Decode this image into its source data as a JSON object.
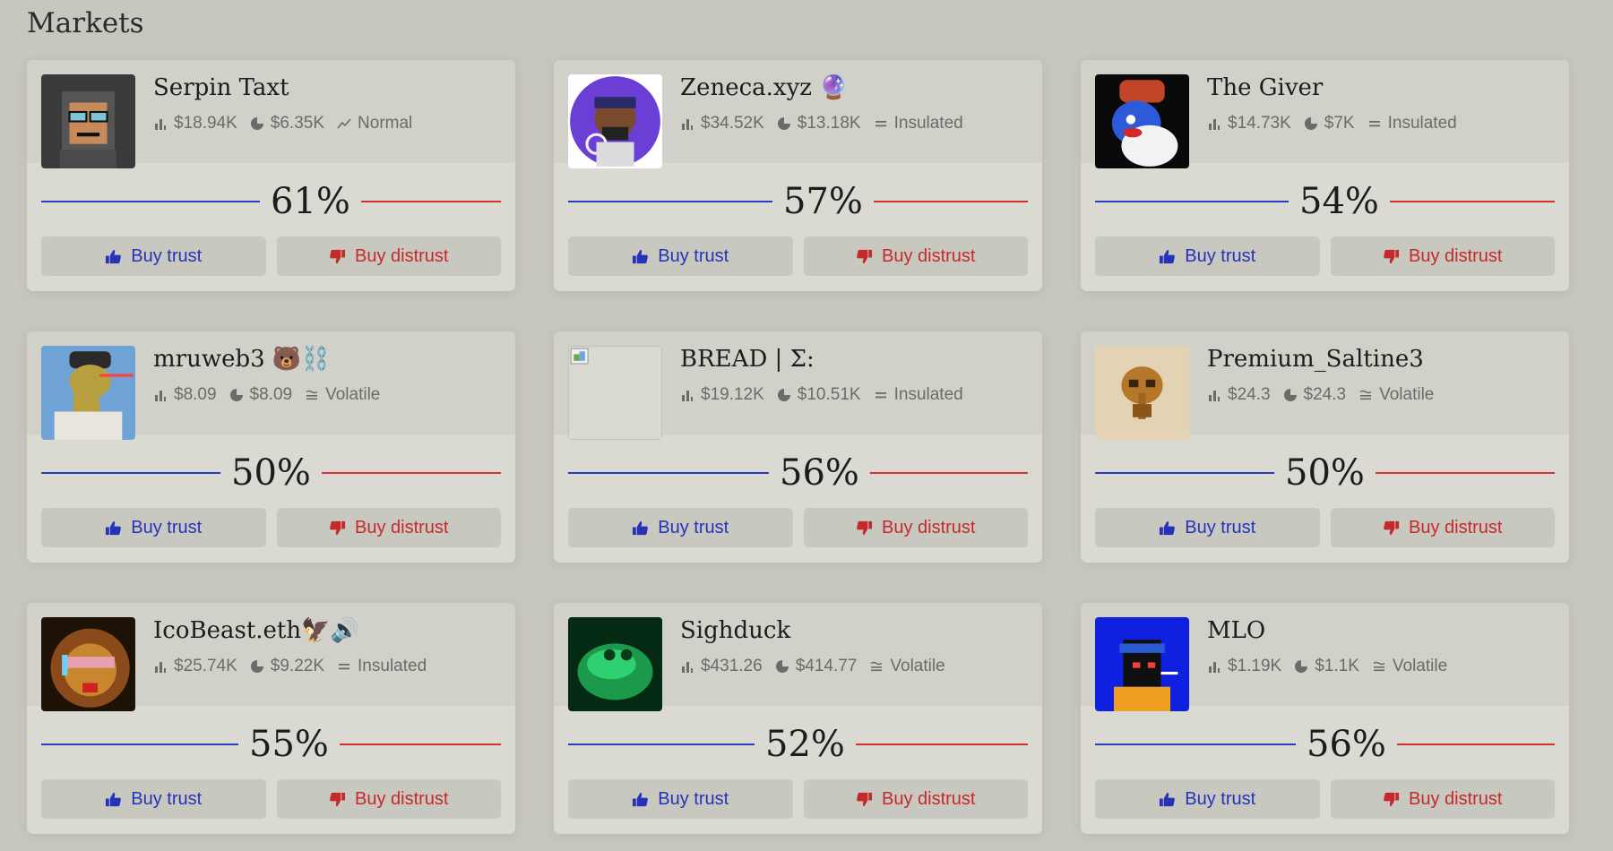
{
  "page": {
    "title": "Markets"
  },
  "markets": [
    {
      "name": "Serpin Taxt",
      "stat1": "$18.94K",
      "stat2": "$6.35K",
      "risk": "Normal",
      "risk_icon": "trend-icon",
      "trust_pct": 61,
      "pct_label": "61%",
      "buy_trust": "Buy trust",
      "buy_distrust": "Buy distrust",
      "avatar": "hooded-pixel-avatar"
    },
    {
      "name": "Zeneca.xyz 🔮",
      "stat1": "$34.52K",
      "stat2": "$13.18K",
      "risk": "Insulated",
      "risk_icon": "equals-icon",
      "trust_pct": 57,
      "pct_label": "57%",
      "buy_trust": "Buy trust",
      "buy_distrust": "Buy distrust",
      "avatar": "purple-circle-avatar"
    },
    {
      "name": "The Giver",
      "stat1": "$14.73K",
      "stat2": "$7K",
      "risk": "Insulated",
      "risk_icon": "equals-icon",
      "trust_pct": 54,
      "pct_label": "54%",
      "buy_trust": "Buy trust",
      "buy_distrust": "Buy distrust",
      "avatar": "blue-face-avatar"
    },
    {
      "name": "mruweb3 🐻⛓️",
      "stat1": "$8.09",
      "stat2": "$8.09",
      "risk": "Volatile",
      "risk_icon": "approx-icon",
      "trust_pct": 50,
      "pct_label": "50%",
      "buy_trust": "Buy trust",
      "buy_distrust": "Buy distrust",
      "avatar": "lizard-avatar"
    },
    {
      "name": "BREAD | Σ:",
      "stat1": "$19.12K",
      "stat2": "$10.51K",
      "risk": "Insulated",
      "risk_icon": "equals-icon",
      "trust_pct": 56,
      "pct_label": "56%",
      "buy_trust": "Buy trust",
      "buy_distrust": "Buy distrust",
      "avatar": "broken-image-avatar"
    },
    {
      "name": "Premium_Saltine3",
      "stat1": "$24.3",
      "stat2": "$24.3",
      "risk": "Volatile",
      "risk_icon": "approx-icon",
      "trust_pct": 50,
      "pct_label": "50%",
      "buy_trust": "Buy trust",
      "buy_distrust": "Buy distrust",
      "avatar": "mask-avatar"
    },
    {
      "name": "IcoBeast.eth🦅🔊",
      "stat1": "$25.74K",
      "stat2": "$9.22K",
      "risk": "Insulated",
      "risk_icon": "equals-icon",
      "trust_pct": 55,
      "pct_label": "55%",
      "buy_trust": "Buy trust",
      "buy_distrust": "Buy distrust",
      "avatar": "lion-avatar"
    },
    {
      "name": "Sighduck",
      "stat1": "$431.26",
      "stat2": "$414.77",
      "risk": "Volatile",
      "risk_icon": "approx-icon",
      "trust_pct": 52,
      "pct_label": "52%",
      "buy_trust": "Buy trust",
      "buy_distrust": "Buy distrust",
      "avatar": "green-frog-avatar"
    },
    {
      "name": "MLO",
      "stat1": "$1.19K",
      "stat2": "$1.1K",
      "risk": "Volatile",
      "risk_icon": "approx-icon",
      "trust_pct": 56,
      "pct_label": "56%",
      "buy_trust": "Buy trust",
      "buy_distrust": "Buy distrust",
      "avatar": "blue-pixel-avatar"
    }
  ],
  "colors": {
    "trust": "#2433b8",
    "distrust": "#c42a2a",
    "bar_blue": "#2b3cc0",
    "bar_red": "#d03232"
  }
}
